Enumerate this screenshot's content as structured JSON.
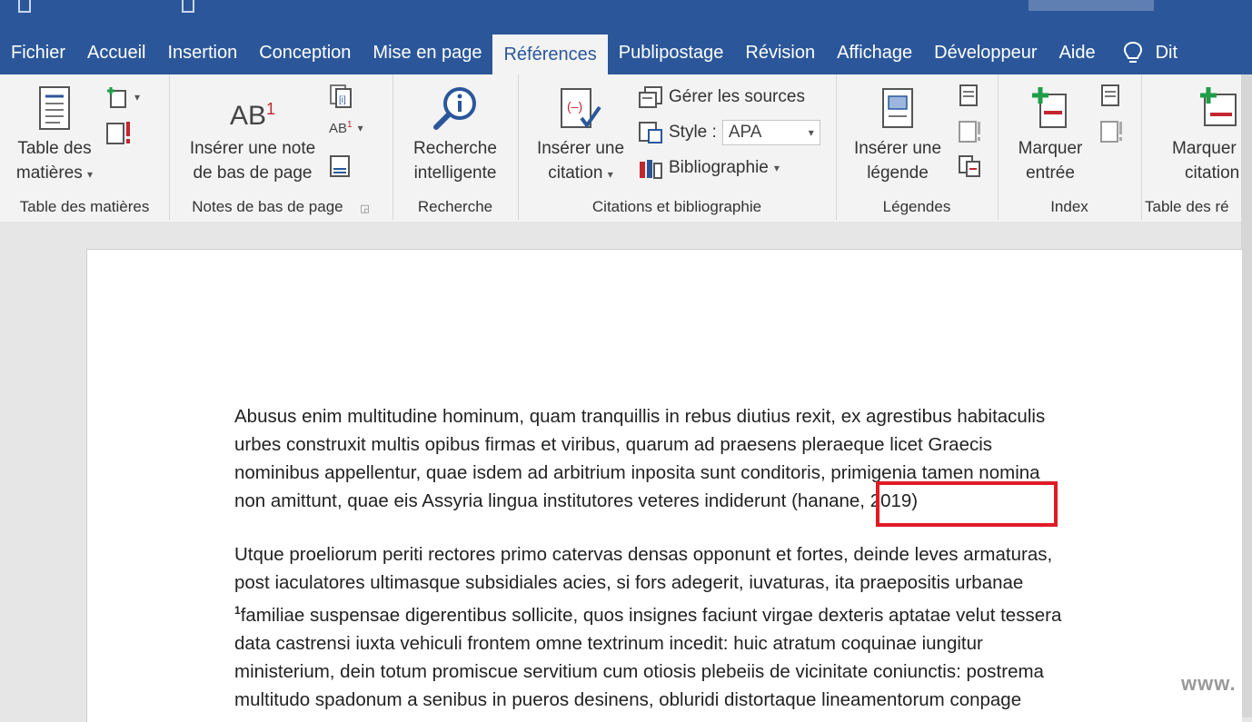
{
  "tabs": [
    "Fichier",
    "Accueil",
    "Insertion",
    "Conception",
    "Mise en page",
    "Références",
    "Publipostage",
    "Révision",
    "Affichage",
    "Développeur",
    "Aide"
  ],
  "active_tab": "Références",
  "tab_search_label": "Dit",
  "groups": {
    "toc": {
      "label": "Table des matières",
      "btn_line1": "Table des",
      "btn_line2": "matières"
    },
    "footnotes": {
      "label": "Notes de bas de page",
      "btn_line1": "Insérer une note",
      "btn_line2": "de bas de page",
      "icon_text": "AB",
      "icon_sup": "1",
      "small_icon_text": "AB",
      "small_icon_sup": "1"
    },
    "research": {
      "label": "Recherche",
      "btn_line1": "Recherche",
      "btn_line2": "intelligente"
    },
    "citations": {
      "label": "Citations et bibliographie",
      "btn_line1": "Insérer une",
      "btn_line2": "citation",
      "manage_sources": "Gérer les sources",
      "style_label": "Style :",
      "style_value": "APA",
      "bibliography": "Bibliographie"
    },
    "captions": {
      "label": "Légendes",
      "btn_line1": "Insérer une",
      "btn_line2": "légende"
    },
    "index": {
      "label": "Index",
      "btn_line1": "Marquer",
      "btn_line2": "entrée"
    },
    "authorities": {
      "label": "Table des ré",
      "btn_line1": "Marquer",
      "btn_line2": "citation"
    }
  },
  "document": {
    "para1": {
      "lines": [
        "Abusus enim multitudine hominum, quam tranquillis in rebus diutius rexit, ex agrestibus habitaculis",
        "urbes construxit multis opibus firmas et viribus, quarum ad praesens pleraeque licet Graecis",
        "nominibus appellentur, quae isdem ad arbitrium inposita sunt conditoris, primigenia tamen nomina",
        "non amittunt, quae eis Assyria lingua institutores veteres indiderunt"
      ],
      "citation": "(hanane, 2019)"
    },
    "para2": {
      "lines": [
        "Utque proeliorum periti rectores primo catervas densas opponunt et fortes, deinde leves armaturas,",
        "post iaculatores ultimasque subsidiales acies, si fors adegerit, iuvaturas, ita praepositis urbanae",
        "familiae suspensae digerentibus sollicite, quos insignes faciunt virgae dexteris aptatae velut tessera",
        "data castrensi iuxta vehiculi frontem omne textrinum incedit: huic atratum coquinae iungitur",
        "ministerium, dein totum promiscue servitium cum otiosis plebeiis de vicinitate coniunctis: postrema",
        "multitudo spadonum a senibus in pueros desinens, obluridi distortaque lineamentorum conpage"
      ],
      "footnote_mark": "1"
    }
  },
  "watermark": "www.",
  "colors": {
    "accent": "#2b579a",
    "highlight": "#e01b24"
  }
}
